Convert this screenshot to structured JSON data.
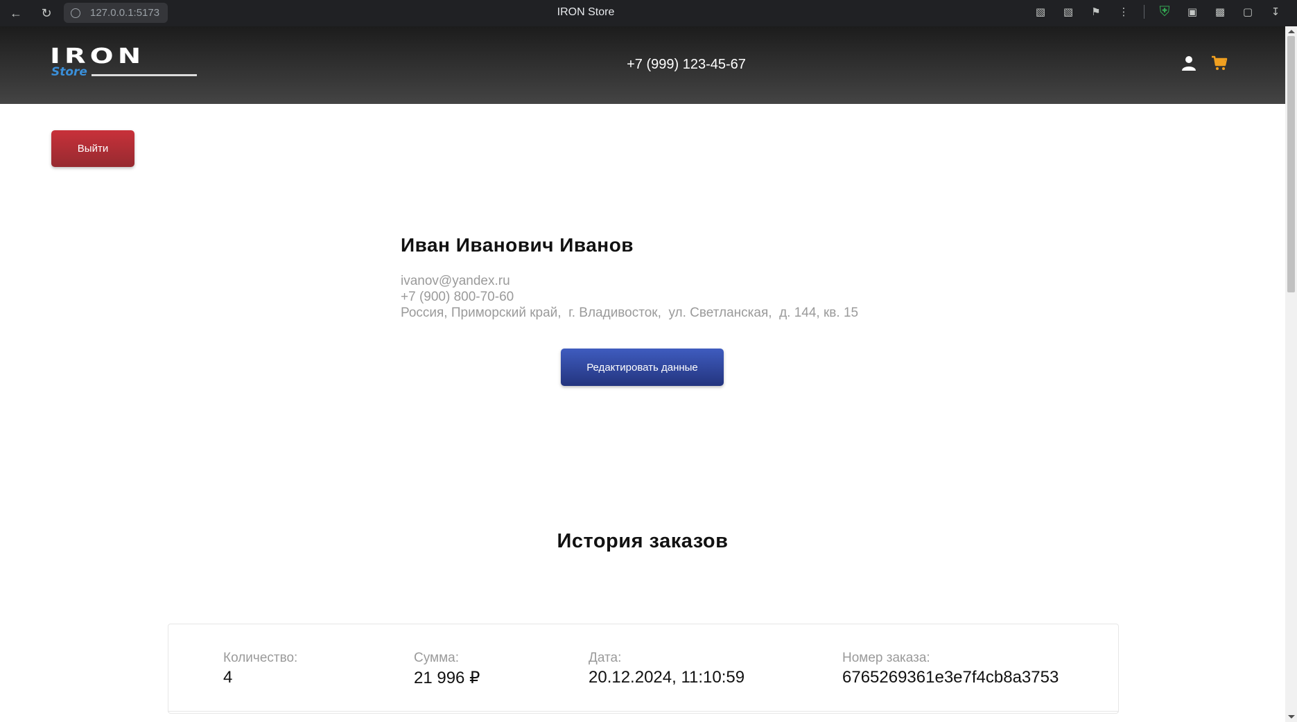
{
  "browser": {
    "url": "127.0.0.1:5173",
    "tab_title": "IRON Store"
  },
  "header": {
    "logo_main": "IRON",
    "logo_sub": "Store",
    "phone": "+7 (999) 123-45-67"
  },
  "actions": {
    "logout_label": "Выйти",
    "edit_label": "Редактировать данные"
  },
  "profile": {
    "name": "Иван Иванович Иванов",
    "email": "ivanov@yandex.ru",
    "phone": "+7 (900) 800-70-60",
    "address": "Россия, Приморский край,  г. Владивосток,  ул. Светланская,  д. 144, кв. 15"
  },
  "orders": {
    "title": "История заказов",
    "items": [
      {
        "quantity_label": "Количество:",
        "quantity": "4",
        "sum_label": "Сумма:",
        "sum": "21 996 ₽",
        "date_label": "Дата:",
        "date": "20.12.2024, 11:10:59",
        "number_label": "Номер заказа:",
        "number": "6765269361e3e7f4cb8a3753"
      }
    ]
  },
  "colors": {
    "logout": "#b02e35",
    "edit": "#2f4499",
    "header_bg": "#2a2a2a",
    "cart": "#f0a020"
  }
}
